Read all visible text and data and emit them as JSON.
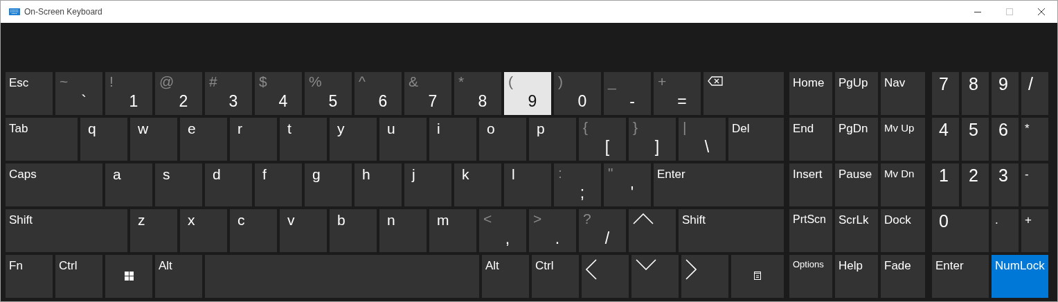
{
  "window": {
    "title": "On-Screen Keyboard",
    "controls": [
      {
        "kind": "minimize",
        "disabled": false
      },
      {
        "kind": "maximize",
        "disabled": true
      },
      {
        "kind": "close",
        "disabled": false
      }
    ]
  },
  "main_rows": [
    [
      {
        "kind": "text",
        "label": "Esc",
        "hovered": false,
        "on": false
      },
      {
        "kind": "dual",
        "shift": "~",
        "label": "`",
        "hovered": false,
        "on": false
      },
      {
        "kind": "dual",
        "shift": "!",
        "label": "1",
        "hovered": false,
        "on": false
      },
      {
        "kind": "dual",
        "shift": "@",
        "label": "2",
        "hovered": false,
        "on": false
      },
      {
        "kind": "dual",
        "shift": "#",
        "label": "3",
        "hovered": false,
        "on": false
      },
      {
        "kind": "dual",
        "shift": "$",
        "label": "4",
        "hovered": false,
        "on": false
      },
      {
        "kind": "dual",
        "shift": "%",
        "label": "5",
        "hovered": false,
        "on": false
      },
      {
        "kind": "dual",
        "shift": "^",
        "label": "6",
        "hovered": false,
        "on": false
      },
      {
        "kind": "dual",
        "shift": "&",
        "label": "7",
        "hovered": false,
        "on": false
      },
      {
        "kind": "dual",
        "shift": "*",
        "label": "8",
        "hovered": false,
        "on": false
      },
      {
        "kind": "dual",
        "shift": "(",
        "label": "9",
        "hovered": true,
        "on": false
      },
      {
        "kind": "dual",
        "shift": ")",
        "label": "0",
        "hovered": false,
        "on": false
      },
      {
        "kind": "dual",
        "shift": "_",
        "label": "-",
        "hovered": false,
        "on": false
      },
      {
        "kind": "dual",
        "shift": "+",
        "label": "=",
        "hovered": false,
        "on": false
      },
      {
        "kind": "backspace",
        "hovered": false,
        "on": false
      }
    ],
    [
      {
        "kind": "text",
        "label": "Tab",
        "hovered": false,
        "on": false
      },
      {
        "kind": "char",
        "label": "q",
        "hovered": false,
        "on": false
      },
      {
        "kind": "char",
        "label": "w",
        "hovered": false,
        "on": false
      },
      {
        "kind": "char",
        "label": "e",
        "hovered": false,
        "on": false
      },
      {
        "kind": "char",
        "label": "r",
        "hovered": false,
        "on": false
      },
      {
        "kind": "char",
        "label": "t",
        "hovered": false,
        "on": false
      },
      {
        "kind": "char",
        "label": "y",
        "hovered": false,
        "on": false
      },
      {
        "kind": "char",
        "label": "u",
        "hovered": false,
        "on": false
      },
      {
        "kind": "char",
        "label": "i",
        "hovered": false,
        "on": false
      },
      {
        "kind": "char",
        "label": "o",
        "hovered": false,
        "on": false
      },
      {
        "kind": "char",
        "label": "p",
        "hovered": false,
        "on": false
      },
      {
        "kind": "dual",
        "shift": "{",
        "label": "[",
        "hovered": false,
        "on": false
      },
      {
        "kind": "dual",
        "shift": "}",
        "label": "]",
        "hovered": false,
        "on": false
      },
      {
        "kind": "dual",
        "shift": "|",
        "label": "\\",
        "hovered": false,
        "on": false
      },
      {
        "kind": "text",
        "label": "Del",
        "hovered": false,
        "on": false
      }
    ],
    [
      {
        "kind": "text",
        "label": "Caps",
        "hovered": false,
        "on": false
      },
      {
        "kind": "char",
        "label": "a",
        "hovered": false,
        "on": false
      },
      {
        "kind": "char",
        "label": "s",
        "hovered": false,
        "on": false
      },
      {
        "kind": "char",
        "label": "d",
        "hovered": false,
        "on": false
      },
      {
        "kind": "char",
        "label": "f",
        "hovered": false,
        "on": false
      },
      {
        "kind": "char",
        "label": "g",
        "hovered": false,
        "on": false
      },
      {
        "kind": "char",
        "label": "h",
        "hovered": false,
        "on": false
      },
      {
        "kind": "char",
        "label": "j",
        "hovered": false,
        "on": false
      },
      {
        "kind": "char",
        "label": "k",
        "hovered": false,
        "on": false
      },
      {
        "kind": "char",
        "label": "l",
        "hovered": false,
        "on": false
      },
      {
        "kind": "dual",
        "shift": ":",
        "label": ";",
        "hovered": false,
        "on": false
      },
      {
        "kind": "dual",
        "shift": "\"",
        "label": "'",
        "hovered": false,
        "on": false
      },
      {
        "kind": "text",
        "label": "Enter",
        "hovered": false,
        "on": false
      }
    ],
    [
      {
        "kind": "text",
        "label": "Shift",
        "hovered": false,
        "on": false
      },
      {
        "kind": "char",
        "label": "z",
        "hovered": false,
        "on": false
      },
      {
        "kind": "char",
        "label": "x",
        "hovered": false,
        "on": false
      },
      {
        "kind": "char",
        "label": "c",
        "hovered": false,
        "on": false
      },
      {
        "kind": "char",
        "label": "v",
        "hovered": false,
        "on": false
      },
      {
        "kind": "char",
        "label": "b",
        "hovered": false,
        "on": false
      },
      {
        "kind": "char",
        "label": "n",
        "hovered": false,
        "on": false
      },
      {
        "kind": "char",
        "label": "m",
        "hovered": false,
        "on": false
      },
      {
        "kind": "dual",
        "shift": "<",
        "label": ",",
        "hovered": false,
        "on": false
      },
      {
        "kind": "dual",
        "shift": ">",
        "label": ".",
        "hovered": false,
        "on": false
      },
      {
        "kind": "dual",
        "shift": "?",
        "label": "/",
        "hovered": false,
        "on": false
      },
      {
        "kind": "up",
        "hovered": false,
        "on": false
      },
      {
        "kind": "text",
        "label": "Shift",
        "hovered": false,
        "on": false
      }
    ],
    [
      {
        "kind": "text",
        "label": "Fn",
        "hovered": false,
        "on": false
      },
      {
        "kind": "text",
        "label": "Ctrl",
        "hovered": false,
        "on": false
      },
      {
        "kind": "windows",
        "hovered": false,
        "on": false
      },
      {
        "kind": "text",
        "label": "Alt",
        "hovered": false,
        "on": false
      },
      {
        "kind": "space",
        "hovered": false,
        "on": false
      },
      {
        "kind": "text",
        "label": "Alt",
        "hovered": false,
        "on": false
      },
      {
        "kind": "text",
        "label": "Ctrl",
        "hovered": false,
        "on": false
      },
      {
        "kind": "left",
        "hovered": false,
        "on": false
      },
      {
        "kind": "down",
        "hovered": false,
        "on": false
      },
      {
        "kind": "right",
        "hovered": false,
        "on": false
      },
      {
        "kind": "menu",
        "hovered": false,
        "on": false
      }
    ]
  ],
  "side_rows": [
    [
      {
        "kind": "text",
        "label": "Home",
        "hovered": false,
        "on": false
      },
      {
        "kind": "text",
        "label": "PgUp",
        "hovered": false,
        "on": false
      },
      {
        "kind": "text",
        "label": "Nav",
        "hovered": false,
        "on": false
      }
    ],
    [
      {
        "kind": "text",
        "label": "End",
        "hovered": false,
        "on": false
      },
      {
        "kind": "text",
        "label": "PgDn",
        "hovered": false,
        "on": false
      },
      {
        "kind": "text",
        "label": "Mv Up",
        "hovered": false,
        "on": false
      }
    ],
    [
      {
        "kind": "text",
        "label": "Insert",
        "hovered": false,
        "on": false
      },
      {
        "kind": "text",
        "label": "Pause",
        "hovered": false,
        "on": false
      },
      {
        "kind": "text",
        "label": "Mv Dn",
        "hovered": false,
        "on": false
      }
    ],
    [
      {
        "kind": "text",
        "label": "PrtScn",
        "hovered": false,
        "on": false
      },
      {
        "kind": "text",
        "label": "ScrLk",
        "hovered": false,
        "on": false
      },
      {
        "kind": "text",
        "label": "Dock",
        "hovered": false,
        "on": false
      }
    ],
    [
      {
        "kind": "text",
        "label": "Options",
        "hovered": false,
        "on": false
      },
      {
        "kind": "text",
        "label": "Help",
        "hovered": false,
        "on": false
      },
      {
        "kind": "text",
        "label": "Fade",
        "hovered": false,
        "on": false
      }
    ]
  ],
  "numpad_rows": [
    [
      {
        "kind": "num",
        "label": "7",
        "hovered": false,
        "on": false
      },
      {
        "kind": "num",
        "label": "8",
        "hovered": false,
        "on": false
      },
      {
        "kind": "num",
        "label": "9",
        "hovered": false,
        "on": false
      },
      {
        "kind": "num",
        "label": "/",
        "hovered": false,
        "on": false
      }
    ],
    [
      {
        "kind": "num",
        "label": "4",
        "hovered": false,
        "on": false
      },
      {
        "kind": "num",
        "label": "5",
        "hovered": false,
        "on": false
      },
      {
        "kind": "num",
        "label": "6",
        "hovered": false,
        "on": false
      },
      {
        "kind": "text",
        "label": "*",
        "hovered": false,
        "on": false
      }
    ],
    [
      {
        "kind": "num",
        "label": "1",
        "hovered": false,
        "on": false
      },
      {
        "kind": "num",
        "label": "2",
        "hovered": false,
        "on": false
      },
      {
        "kind": "num",
        "label": "3",
        "hovered": false,
        "on": false
      },
      {
        "kind": "text",
        "label": "-",
        "hovered": false,
        "on": false
      }
    ],
    [
      {
        "kind": "num",
        "label": "0",
        "hovered": false,
        "on": false
      },
      {
        "kind": "text",
        "label": ".",
        "hovered": false,
        "on": false
      },
      {
        "kind": "text",
        "label": "+",
        "hovered": false,
        "on": false
      }
    ],
    [
      {
        "kind": "text",
        "label": "Enter",
        "hovered": false,
        "on": false
      },
      {
        "kind": "text",
        "label": "NumLock",
        "hovered": false,
        "on": true
      }
    ]
  ]
}
